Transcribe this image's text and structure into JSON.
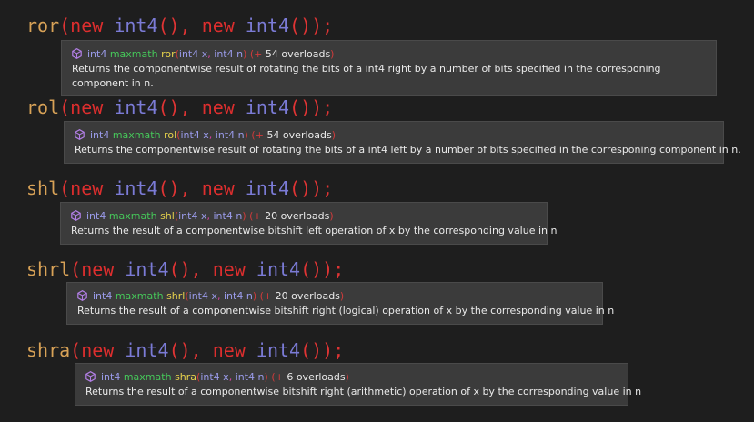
{
  "colors": {
    "background": "#1e1e1e",
    "tooltip_bg": "#3b3b3b",
    "method_name": "#d8a257",
    "keyword": "#dd2e2e",
    "type": "#7b7bd6",
    "namespace": "#46c85a",
    "tooltip_fn": "#e7d24c",
    "param_sep": "#d2409c",
    "method_icon": "#b27fe5"
  },
  "icon": "method-cube-icon",
  "entries": [
    {
      "method": "ror",
      "arg1_kw": "new",
      "arg1_type": "int4",
      "arg1_parens": "(),",
      "arg2_kw": "new",
      "arg2_type": "int4",
      "arg2_parens": "());",
      "open_paren": "(",
      "tooltip": {
        "return_type": "int4",
        "namespace": "maxmath",
        "name": "ror",
        "p_open": "(",
        "p1_type": "int4",
        "p1_name": "x",
        "sep": ",",
        "p2_type": "int4",
        "p2_name": "n",
        "p_close": ")",
        "ov_open": "(+",
        "overloads": "54 overloads",
        "ov_close": ")",
        "description": "Returns the componentwise result of rotating the bits of a int4 right by a number of bits specified in the corresponing component in n."
      }
    },
    {
      "method": "rol",
      "arg1_kw": "new",
      "arg1_type": "int4",
      "arg1_parens": "(),",
      "arg2_kw": "new",
      "arg2_type": "int4",
      "arg2_parens": "());",
      "open_paren": "(",
      "tooltip": {
        "return_type": "int4",
        "namespace": "maxmath",
        "name": "rol",
        "p_open": "(",
        "p1_type": "int4",
        "p1_name": "x",
        "sep": ",",
        "p2_type": "int4",
        "p2_name": "n",
        "p_close": ")",
        "ov_open": "(+",
        "overloads": "54 overloads",
        "ov_close": ")",
        "description": "Returns the componentwise result of rotating the bits of a int4 left by a number of bits specified in the corresponing component in n."
      }
    },
    {
      "method": "shl",
      "arg1_kw": "new",
      "arg1_type": "int4",
      "arg1_parens": "(),",
      "arg2_kw": "new",
      "arg2_type": "int4",
      "arg2_parens": "());",
      "open_paren": "(",
      "tooltip": {
        "return_type": "int4",
        "namespace": "maxmath",
        "name": "shl",
        "p_open": "(",
        "p1_type": "int4",
        "p1_name": "x",
        "sep": ",",
        "p2_type": "int4",
        "p2_name": "n",
        "p_close": ")",
        "ov_open": "(+",
        "overloads": "20 overloads",
        "ov_close": ")",
        "description": "Returns the result of a componentwise bitshift left operation of x by the corresponding value in n"
      }
    },
    {
      "method": "shrl",
      "arg1_kw": "new",
      "arg1_type": "int4",
      "arg1_parens": "(),",
      "arg2_kw": "new",
      "arg2_type": "int4",
      "arg2_parens": "());",
      "open_paren": "(",
      "tooltip": {
        "return_type": "int4",
        "namespace": "maxmath",
        "name": "shrl",
        "p_open": "(",
        "p1_type": "int4",
        "p1_name": "x",
        "sep": ",",
        "p2_type": "int4",
        "p2_name": "n",
        "p_close": ")",
        "ov_open": "(+",
        "overloads": "20 overloads",
        "ov_close": ")",
        "description": "Returns the result of a componentwise bitshift right (logical) operation of x by the corresponding value in n"
      }
    },
    {
      "method": "shra",
      "arg1_kw": "new",
      "arg1_type": "int4",
      "arg1_parens": "(),",
      "arg2_kw": "new",
      "arg2_type": "int4",
      "arg2_parens": "());",
      "open_paren": "(",
      "tooltip": {
        "return_type": "int4",
        "namespace": "maxmath",
        "name": "shra",
        "p_open": "(",
        "p1_type": "int4",
        "p1_name": "x",
        "sep": ",",
        "p2_type": "int4",
        "p2_name": "n",
        "p_close": ")",
        "ov_open": "(+",
        "overloads": "6 overloads",
        "ov_close": ")",
        "description": "Returns the result of a componentwise bitshift right (arithmetic) operation of x by the corresponding value in n"
      }
    }
  ]
}
